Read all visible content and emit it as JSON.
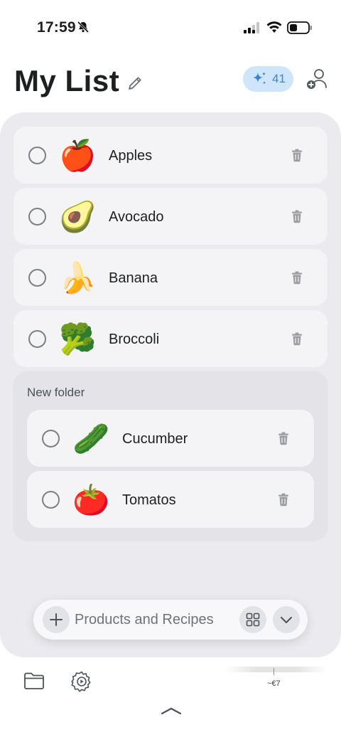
{
  "status_bar": {
    "time": "17:59"
  },
  "header": {
    "title": "My List",
    "ai_credits": "41"
  },
  "items": [
    {
      "name": "Apples",
      "emoji": "🍎"
    },
    {
      "name": "Avocado",
      "emoji": "🥑"
    },
    {
      "name": "Banana",
      "emoji": "🍌"
    },
    {
      "name": "Broccoli",
      "emoji": "🥦"
    }
  ],
  "folder": {
    "title": "New folder",
    "items": [
      {
        "name": "Cucumber",
        "emoji": "🥒"
      },
      {
        "name": "Tomatos",
        "emoji": "🍅"
      }
    ]
  },
  "add_bar": {
    "placeholder": "Products and Recipes"
  },
  "footer": {
    "price_estimate": "~€7"
  },
  "colors": {
    "accent": "#3b82d6",
    "badge_bg": "#cfe6fa",
    "panel_bg": "#ebebef"
  }
}
